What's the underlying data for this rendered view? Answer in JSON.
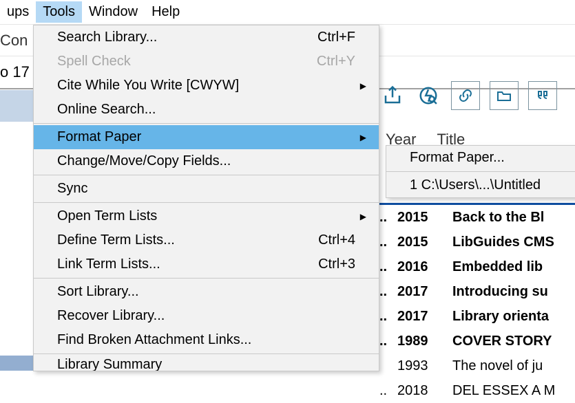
{
  "menubar": {
    "items": [
      {
        "label": "ups"
      },
      {
        "label": "Tools"
      },
      {
        "label": "Window"
      },
      {
        "label": "Help"
      }
    ]
  },
  "subheader": {
    "left": "Con",
    "row2": "o 17"
  },
  "tools_menu": {
    "search_library": "Search Library...",
    "search_library_sc": "Ctrl+F",
    "spell_check": "Spell Check",
    "spell_check_sc": "Ctrl+Y",
    "cwyw": "Cite While You Write [CWYW]",
    "online_search": "Online Search...",
    "format_paper": "Format Paper",
    "change_move": "Change/Move/Copy Fields...",
    "sync": "Sync",
    "open_term": "Open Term Lists",
    "define_term": "Define Term Lists...",
    "define_term_sc": "Ctrl+4",
    "link_term": "Link Term Lists...",
    "link_term_sc": "Ctrl+3",
    "sort_lib": "Sort Library...",
    "recover_lib": "Recover Library...",
    "find_broken": "Find Broken Attachment Links...",
    "lib_summary": "Library Summary"
  },
  "submenu": {
    "format_paper": "Format Paper...",
    "recent": "1 C:\\Users\\...\\Untitled "
  },
  "columns": {
    "year": "Year",
    "title": "Title"
  },
  "refs": [
    {
      "dots": "..",
      "year": "2015",
      "title": "Back to the Bl",
      "bold": true
    },
    {
      "dots": "..",
      "year": "2015",
      "title": "LibGuides CMS",
      "bold": true
    },
    {
      "dots": "..",
      "year": "2016",
      "title": "Embedded lib",
      "bold": true
    },
    {
      "dots": "..",
      "year": "2017",
      "title": "Introducing su",
      "bold": true
    },
    {
      "dots": "..",
      "year": "2017",
      "title": "Library orienta",
      "bold": true
    },
    {
      "dots": "..",
      "year": "1989",
      "title": "COVER STORY",
      "bold": true
    },
    {
      "dots": "",
      "year": "1993",
      "title": "The novel of ju",
      "bold": false
    },
    {
      "dots": "..",
      "year": "2018",
      "title": "DEL ESSEX A M",
      "bold": false
    }
  ]
}
